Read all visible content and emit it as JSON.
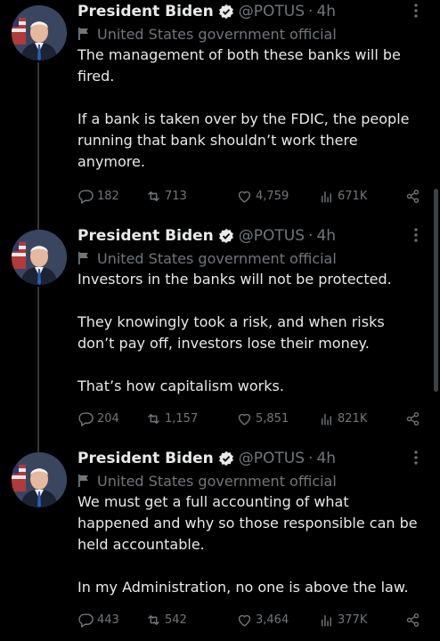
{
  "author": {
    "name": "President Biden",
    "handle": "@POTUS",
    "label": "United States government official",
    "verified_color": "#1d9bf0"
  },
  "tweets": [
    {
      "time": "4h",
      "paragraphs": [
        "The management of both these banks will be fired.",
        "If a bank is taken over by the FDIC, the people running that bank shouldn’t work there anymore."
      ],
      "replies": "182",
      "retweets": "713",
      "likes": "4,759",
      "views": "671K"
    },
    {
      "time": "4h",
      "paragraphs": [
        "Investors in the banks will not be protected.",
        "They knowingly took a risk, and when risks don’t pay off, investors lose their money.",
        "That’s how capitalism works."
      ],
      "replies": "204",
      "retweets": "1,157",
      "likes": "5,851",
      "views": "821K"
    },
    {
      "time": "4h",
      "paragraphs": [
        "We must get a full accounting of what happened and why so those responsible can be held accountable.",
        "In my Administration, no one is above the law."
      ],
      "replies": "443",
      "retweets": "542",
      "likes": "3,464",
      "views": "377K"
    }
  ],
  "icons": {
    "verified": "verified-badge-icon",
    "label": "government-flag-icon",
    "more": "more-options-icon",
    "reply": "reply-icon",
    "retweet": "retweet-icon",
    "like": "heart-icon",
    "views": "views-chart-icon",
    "share": "share-icon"
  },
  "colors": {
    "background": "#000000",
    "text": "#e7e9ea",
    "muted": "#71767b",
    "thread_line": "#333639"
  }
}
